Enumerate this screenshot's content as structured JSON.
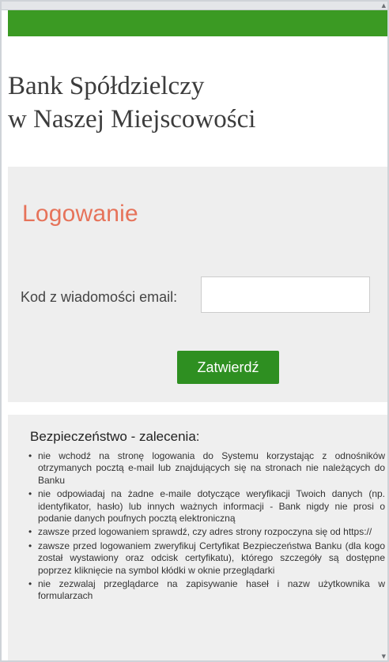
{
  "header": {
    "bank_name_line1": "Bank Spółdzielczy",
    "bank_name_line2": "w Naszej Miejscowości",
    "accent_color": "#3b9a23"
  },
  "login": {
    "title": "Logowanie",
    "code_label": "Kod z wiadomości email:",
    "code_value": "",
    "submit_label": "Zatwierdź",
    "title_color": "#e6735a",
    "button_color": "#2e8f21"
  },
  "security": {
    "title": "Bezpieczeństwo - zalecenia:",
    "items": [
      "nie wchodź na stronę logowania do Systemu korzystając z odnośników otrzymanych pocztą e-mail lub znajdujących się na stronach nie należących do Banku",
      "nie odpowiadaj na żadne e-maile dotyczące weryfikacji Twoich danych (np. identyfikator, hasło) lub innych ważnych informacji - Bank nigdy nie prosi o podanie danych poufnych pocztą elektroniczną",
      "zawsze przed logowaniem sprawdź, czy adres strony rozpoczyna się od https://",
      "zawsze przed logowaniem zweryfikuj Certyfikat Bezpieczeństwa Banku (dla kogo został wystawiony oraz odcisk certyfikatu), którego szczegóły są dostępne poprzez kliknięcie na symbol kłódki w oknie przeglądarki",
      "nie zezwalaj przeglądarce na zapisywanie haseł i nazw użytkownika w formularzach"
    ]
  },
  "icons": {
    "scroll_up": "▲",
    "scroll_down": "▼"
  }
}
